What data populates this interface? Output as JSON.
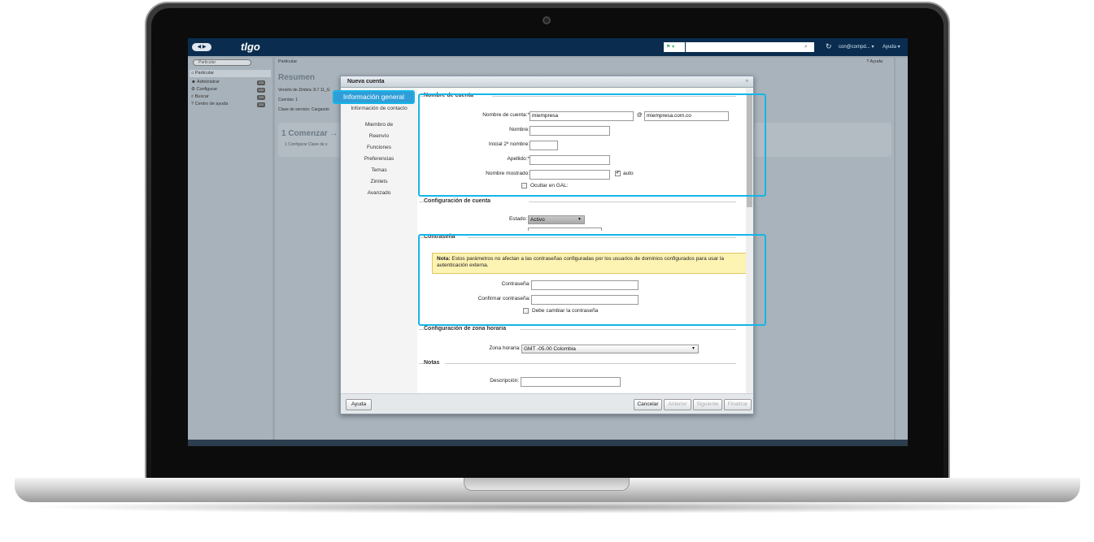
{
  "app": {
    "logo": "tlgo",
    "search_type": "▾",
    "user": "con@compd... ▾",
    "help_menu": "Ayuda ▾"
  },
  "left_pane": {
    "context": "Particular",
    "items": [
      {
        "label": "Particular",
        "icon": "house-icon"
      },
      {
        "label": "Administrar",
        "icon": "people-icon",
        "badge": "220"
      },
      {
        "label": "Configurar",
        "icon": "gear-icon",
        "badge": "220"
      },
      {
        "label": "Buscar",
        "icon": "search-icon",
        "badge": "220"
      },
      {
        "label": "Centro de ayuda",
        "icon": "help-icon",
        "badge": "220"
      }
    ]
  },
  "main": {
    "breadcrumb": "Particular",
    "help": "Ayuda",
    "title": "Resumen",
    "lines": [
      "Versión de Zimbra: 8.7.11_G",
      "Cuentas:        1",
      "Clase de servicio:  Cargando"
    ],
    "comenzar": "1 Comenzar →",
    "comenzar_step": "1    Configurar Clase de s"
  },
  "dialog": {
    "title": "Nueva cuenta",
    "nav": [
      "Información general",
      "Información de contacto",
      "Miembro de",
      "Reenvío",
      "Funciones",
      "Preferencias",
      "Temas",
      "Zimlets",
      "Avanzado"
    ],
    "cuenta": {
      "section": "Nombre de cuenta",
      "account_label": "Nombre de cuenta:*",
      "account_value": "miempresa",
      "at": "@",
      "domain_value": "miempresa.com.co",
      "nombre_label": "Nombre:",
      "inicial_label": "Inicial 2º nombre:",
      "apellido_label": "Apellido:*",
      "mostrado_label": "Nombre mostrado:",
      "auto_label": "auto",
      "gal_label": "Ocultar en GAL:"
    },
    "config": {
      "section": "Configuración de cuenta",
      "estado_label": "Estado:",
      "estado_value": "Activo"
    },
    "password": {
      "section": "Contraseña",
      "note_bold": "Nota:",
      "note": "Estos parámetros no afectan a las contraseñas configuradas por los usuarios de dominios configurados para usar la autenticación externa.",
      "pass_label": "Contraseña:",
      "confirm_label": "Confirmar contraseña:",
      "must_change_label": "Debe cambiar la contraseña"
    },
    "timezone": {
      "section": "Configuración de zona horaria",
      "label": "Zona horaria:",
      "value": "GMT -05.00 Colombia"
    },
    "notes": {
      "section": "Notas",
      "desc_label": "Descripción:"
    },
    "footer": {
      "help": "Ayuda",
      "cancel": "Cancelar",
      "prev": "Anterior",
      "next": "Siguiente",
      "finish": "Finalizar"
    }
  },
  "colors": {
    "highlight": "#15b5e8",
    "topbar": "#0a2d4f",
    "note_bg": "#fdf3b3"
  }
}
